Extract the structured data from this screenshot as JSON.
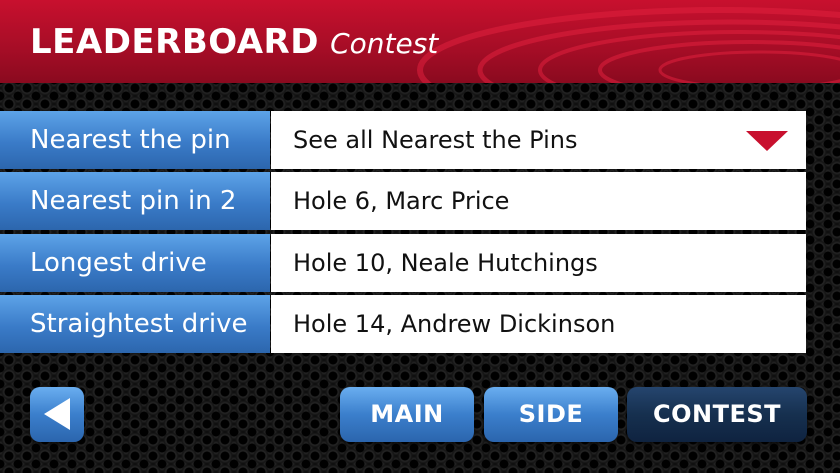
{
  "header": {
    "title": "LEADERBOARD",
    "subtitle": "Contest"
  },
  "contests": [
    {
      "label": "Nearest the pin",
      "value": "See all Nearest the Pins",
      "has_dropdown": true
    },
    {
      "label": "Nearest pin in 2",
      "value": "Hole 6, Marc Price"
    },
    {
      "label": "Longest drive",
      "value": "Hole 10, Neale Hutchings"
    },
    {
      "label": "Straightest drive",
      "value": "Hole 14, Andrew Dickinson"
    }
  ],
  "nav": {
    "back_icon": "back-arrow-icon",
    "main_label": "MAIN",
    "side_label": "SIDE",
    "contest_label": "CONTEST",
    "active": "contest"
  },
  "colors": {
    "header_red": "#c8102e",
    "label_blue": "#3a7bc8",
    "active_button": "#16304f",
    "dropdown_arrow": "#c8102e"
  }
}
